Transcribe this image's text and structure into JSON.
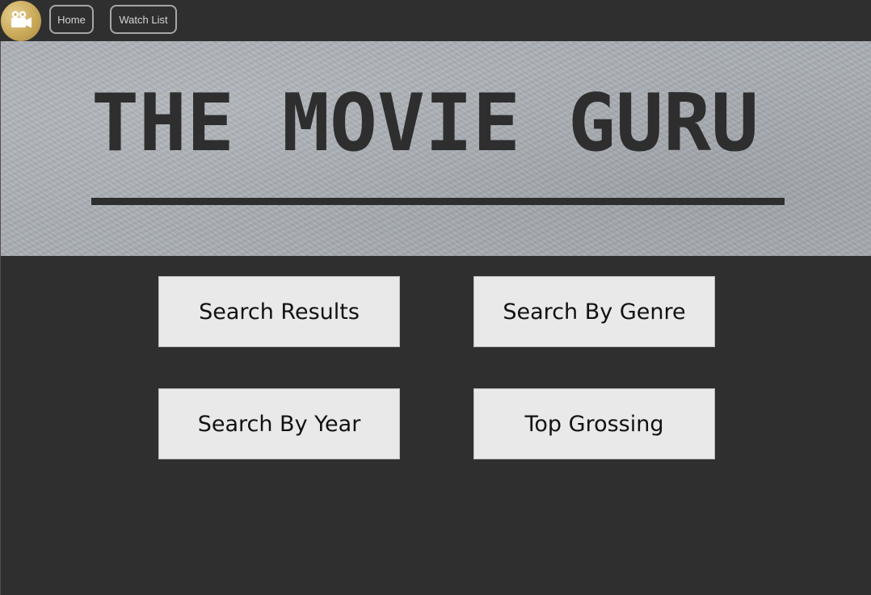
{
  "nav": {
    "logo_icon": "video-camera-icon",
    "home_label": "Home",
    "watch_list_label": "Watch List"
  },
  "hero": {
    "title": "THE MOVIE GURU"
  },
  "actions": {
    "search_results": "Search Results",
    "search_by_genre": "Search By Genre",
    "search_by_year": "Search By Year",
    "top_grossing": "Top Grossing"
  },
  "colors": {
    "background": "#2f2f2f",
    "banner": "#a9aeb4",
    "button_bg": "#e9e9e9",
    "logo_gold": "#c9a95a",
    "title_text": "#2e2e2e"
  }
}
